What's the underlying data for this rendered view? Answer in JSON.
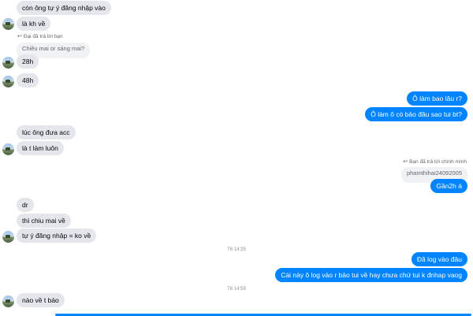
{
  "messages": {
    "m1": "còn ông tự ý đăng nhập vào",
    "m2": "là kh về",
    "reply1_note": "Đại đã trả lời bạn",
    "reply1_quote": "Chiều mai or sáng mai?",
    "m3": "28h",
    "m4": "48h",
    "o1": "Ô làm bao lâu r?",
    "o2": "Ô làm ô có bảo đâu sao tui bt?",
    "m5": "lúc ông đưa acc",
    "m6": "là t làm luôn",
    "reply2_note": "Bạn đã trả lời chính mình",
    "reply2_quote": "phamthihai24092005",
    "o3": "Gần2h á",
    "m7": "dr",
    "m8": "thì chiu mai về",
    "m9": "tự ý đăng nhập = ko về",
    "ts1": "T6 14:25",
    "o4": "Đã log vào đâu",
    "o5": "Cái này ô log vào r bảo tui về hay chưa chứ tui k đnhap vaog",
    "ts2": "T6 14:59",
    "m10": "nào về t bảo"
  },
  "icons": {
    "reply": "reply-arrow-icon",
    "avatar": "avatar"
  },
  "colors": {
    "outgoing": "#0084ff",
    "incoming": "#e4e6eb"
  }
}
